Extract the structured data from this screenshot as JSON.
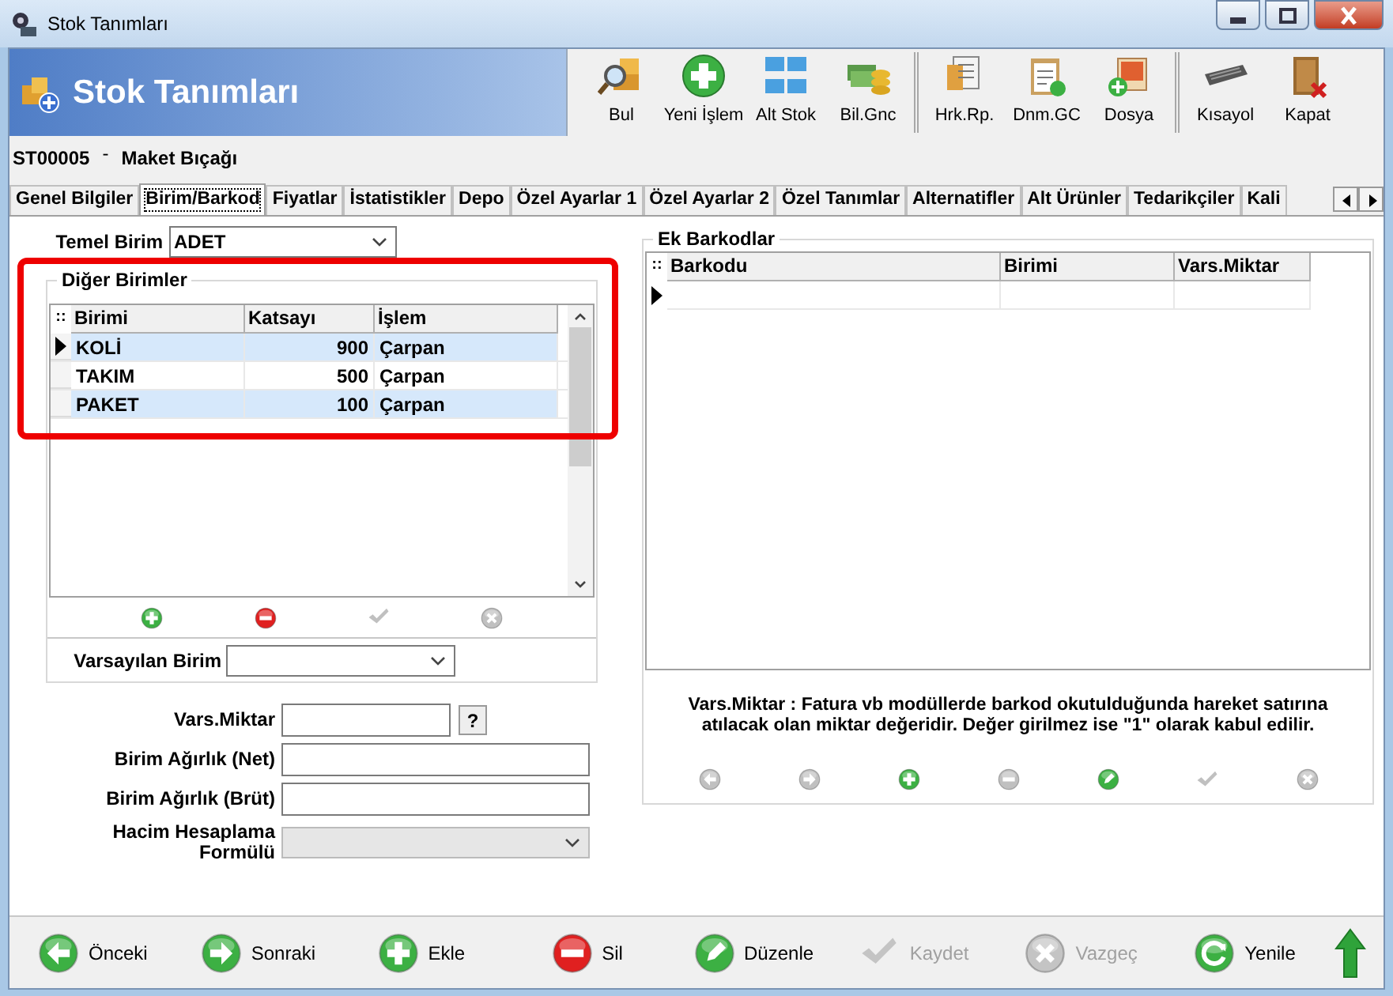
{
  "window": {
    "title": "Stok Tanımları"
  },
  "header": {
    "title": "Stok Tanımları"
  },
  "toolbar_groups": [
    [
      {
        "label": "Bul"
      },
      {
        "label": "Yeni İşlem"
      },
      {
        "label": "Alt Stok"
      },
      {
        "label": "Bil.Gnc"
      }
    ],
    [
      {
        "label": "Hrk.Rp."
      },
      {
        "label": "Dnm.GC"
      },
      {
        "label": "Dosya"
      }
    ],
    [
      {
        "label": "Kısayol"
      },
      {
        "label": "Kapat"
      }
    ]
  ],
  "record": {
    "code": "ST00005",
    "separator": "-",
    "name": "Maket Bıçağı"
  },
  "tabs": [
    {
      "label": "Genel Bilgiler",
      "selected": false
    },
    {
      "label": "Birim/Barkod",
      "selected": true
    },
    {
      "label": "Fiyatlar",
      "selected": false
    },
    {
      "label": "İstatistikler",
      "selected": false
    },
    {
      "label": "Depo",
      "selected": false
    },
    {
      "label": "Özel Ayarlar 1",
      "selected": false
    },
    {
      "label": "Özel Ayarlar 2",
      "selected": false
    },
    {
      "label": "Özel Tanımlar",
      "selected": false
    },
    {
      "label": "Alternatifler",
      "selected": false
    },
    {
      "label": "Alt Ürünler",
      "selected": false
    },
    {
      "label": "Tedarikçiler",
      "selected": false
    },
    {
      "label": "Kali",
      "selected": false
    }
  ],
  "base_unit": {
    "label": "Temel Birim",
    "value": "ADET"
  },
  "other_units": {
    "title": "Diğer Birimler",
    "indicator": "::",
    "columns": [
      "Birimi",
      "Katsayı",
      "İşlem"
    ],
    "rows": [
      {
        "cells": [
          "KOLİ",
          "900",
          "Çarpan"
        ],
        "selected": true
      },
      {
        "cells": [
          "TAKIM",
          "500",
          "Çarpan"
        ],
        "selected": false
      },
      {
        "cells": [
          "PAKET",
          "100",
          "Çarpan"
        ],
        "selected": false
      }
    ],
    "buttons": [
      {
        "disabled": false
      },
      {
        "disabled": false
      },
      {
        "disabled": true
      },
      {
        "disabled": true
      }
    ],
    "default_unit": {
      "label": "Varsayılan Birim"
    }
  },
  "fields": [
    {
      "label": "Vars.Miktar",
      "kind": "text",
      "help": "?",
      "disabled": false
    },
    {
      "label": "Birim Ağırlık (Net)",
      "kind": "text",
      "disabled": false
    },
    {
      "label": "Birim Ağırlık (Brüt)",
      "kind": "text",
      "disabled": false
    },
    {
      "label": "Hacim Hesaplama Formülü",
      "kind": "select",
      "disabled": true
    }
  ],
  "extra_barcodes": {
    "title": "Ek Barkodlar",
    "indicator": "::",
    "columns": [
      "Barkodu",
      "Birimi",
      "Vars.Miktar"
    ],
    "rows": [
      {
        "selected": true
      }
    ],
    "note": "Vars.Miktar : Fatura vb modüllerde barkod okutulduğunda hareket satırına atılacak olan miktar değeridir. Değer girilmez ise \"1\" olarak kabul edilir.",
    "buttons": [
      {
        "disabled": true
      },
      {
        "disabled": true
      },
      {
        "disabled": false
      },
      {
        "disabled": true
      },
      {
        "disabled": false
      },
      {
        "disabled": true
      },
      {
        "disabled": true
      }
    ]
  },
  "bottom_bar": [
    {
      "label": "Önceki",
      "disabled": false
    },
    {
      "label": "Sonraki",
      "disabled": false
    },
    {
      "label": "Ekle",
      "disabled": false
    },
    {
      "label": "Sil",
      "disabled": false
    },
    {
      "label": "Düzenle",
      "disabled": false
    },
    {
      "label": "Kaydet",
      "disabled": true
    },
    {
      "label": "Vazgeç",
      "disabled": true
    },
    {
      "label": "Yenile",
      "disabled": false
    }
  ]
}
